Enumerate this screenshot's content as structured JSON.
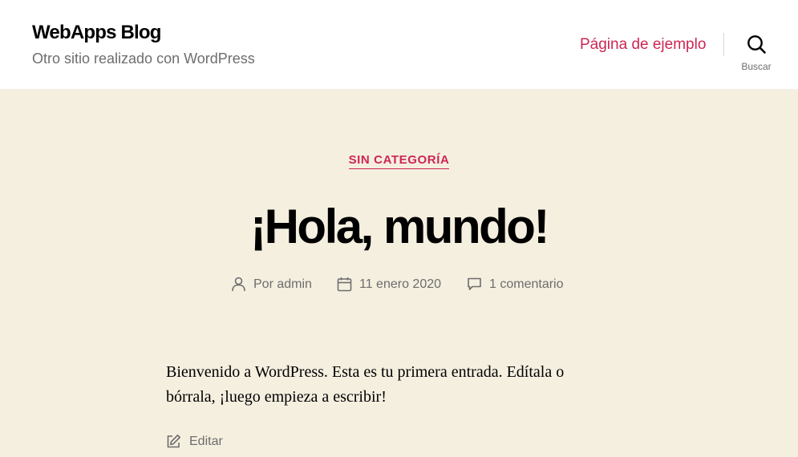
{
  "site": {
    "title": "WebApps Blog",
    "description": "Otro sitio realizado con WordPress"
  },
  "nav": {
    "items": [
      {
        "label": "Página de ejemplo"
      }
    ]
  },
  "search": {
    "label": "Buscar",
    "icon": "search-icon"
  },
  "post": {
    "category": "SIN CATEGORÍA",
    "title": "¡Hola, mundo!",
    "meta": {
      "author_prefix": "Por",
      "author": "admin",
      "date": "11 enero 2020",
      "comments": "1 comentario"
    },
    "body": "Bienvenido a WordPress. Esta es tu primera entrada. Edítala o bórrala, ¡luego empieza a escribir!",
    "edit_label": "Editar"
  },
  "colors": {
    "accent": "#cd2653",
    "background": "#f5efe0",
    "header_background": "#ffffff",
    "secondary_text": "#6d6d6d"
  }
}
